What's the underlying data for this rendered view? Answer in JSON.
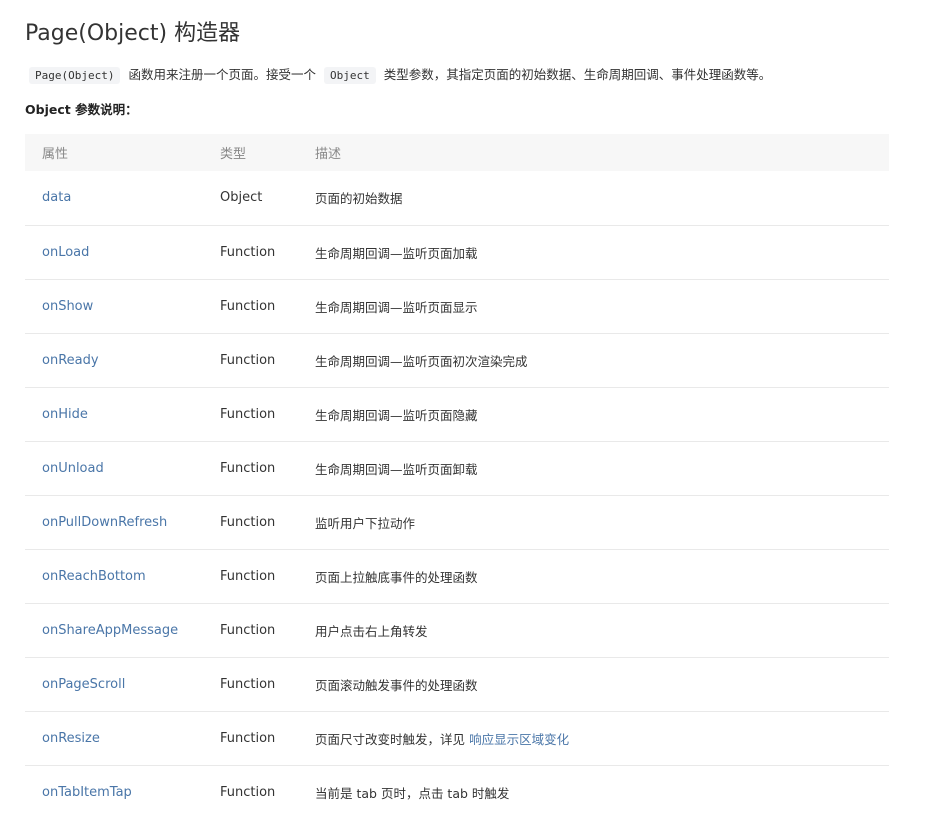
{
  "title": "Page(Object) 构造器",
  "intro": {
    "code1": "Page(Object)",
    "text1": "函数用来注册一个页面。接受一个",
    "code2": "Object",
    "text2": "类型参数，其指定页面的初始数据、生命周期回调、事件处理函数等。"
  },
  "section_label": "Object 参数说明：",
  "table": {
    "headers": [
      "属性",
      "类型",
      "描述"
    ],
    "rows": [
      {
        "attr": "data",
        "type": "Object",
        "desc": "页面的初始数据"
      },
      {
        "attr": "onLoad",
        "type": "Function",
        "desc": "生命周期回调—监听页面加载"
      },
      {
        "attr": "onShow",
        "type": "Function",
        "desc": "生命周期回调—监听页面显示"
      },
      {
        "attr": "onReady",
        "type": "Function",
        "desc": "生命周期回调—监听页面初次渲染完成"
      },
      {
        "attr": "onHide",
        "type": "Function",
        "desc": "生命周期回调—监听页面隐藏"
      },
      {
        "attr": "onUnload",
        "type": "Function",
        "desc": "生命周期回调—监听页面卸载"
      },
      {
        "attr": "onPullDownRefresh",
        "type": "Function",
        "desc": "监听用户下拉动作"
      },
      {
        "attr": "onReachBottom",
        "type": "Function",
        "desc": "页面上拉触底事件的处理函数"
      },
      {
        "attr": "onShareAppMessage",
        "type": "Function",
        "desc": "用户点击右上角转发"
      },
      {
        "attr": "onPageScroll",
        "type": "Function",
        "desc": "页面滚动触发事件的处理函数"
      },
      {
        "attr": "onResize",
        "type": "Function",
        "desc": "页面尺寸改变时触发，详见",
        "desc_link": "响应显示区域变化"
      },
      {
        "attr": "onTabItemTap",
        "type": "Function",
        "desc": "当前是 tab 页时，点击 tab 时触发"
      }
    ]
  },
  "colors": {
    "link": "#4a76a8",
    "header_bg": "#f7f7f7",
    "row_border": "#e9e9e9"
  }
}
